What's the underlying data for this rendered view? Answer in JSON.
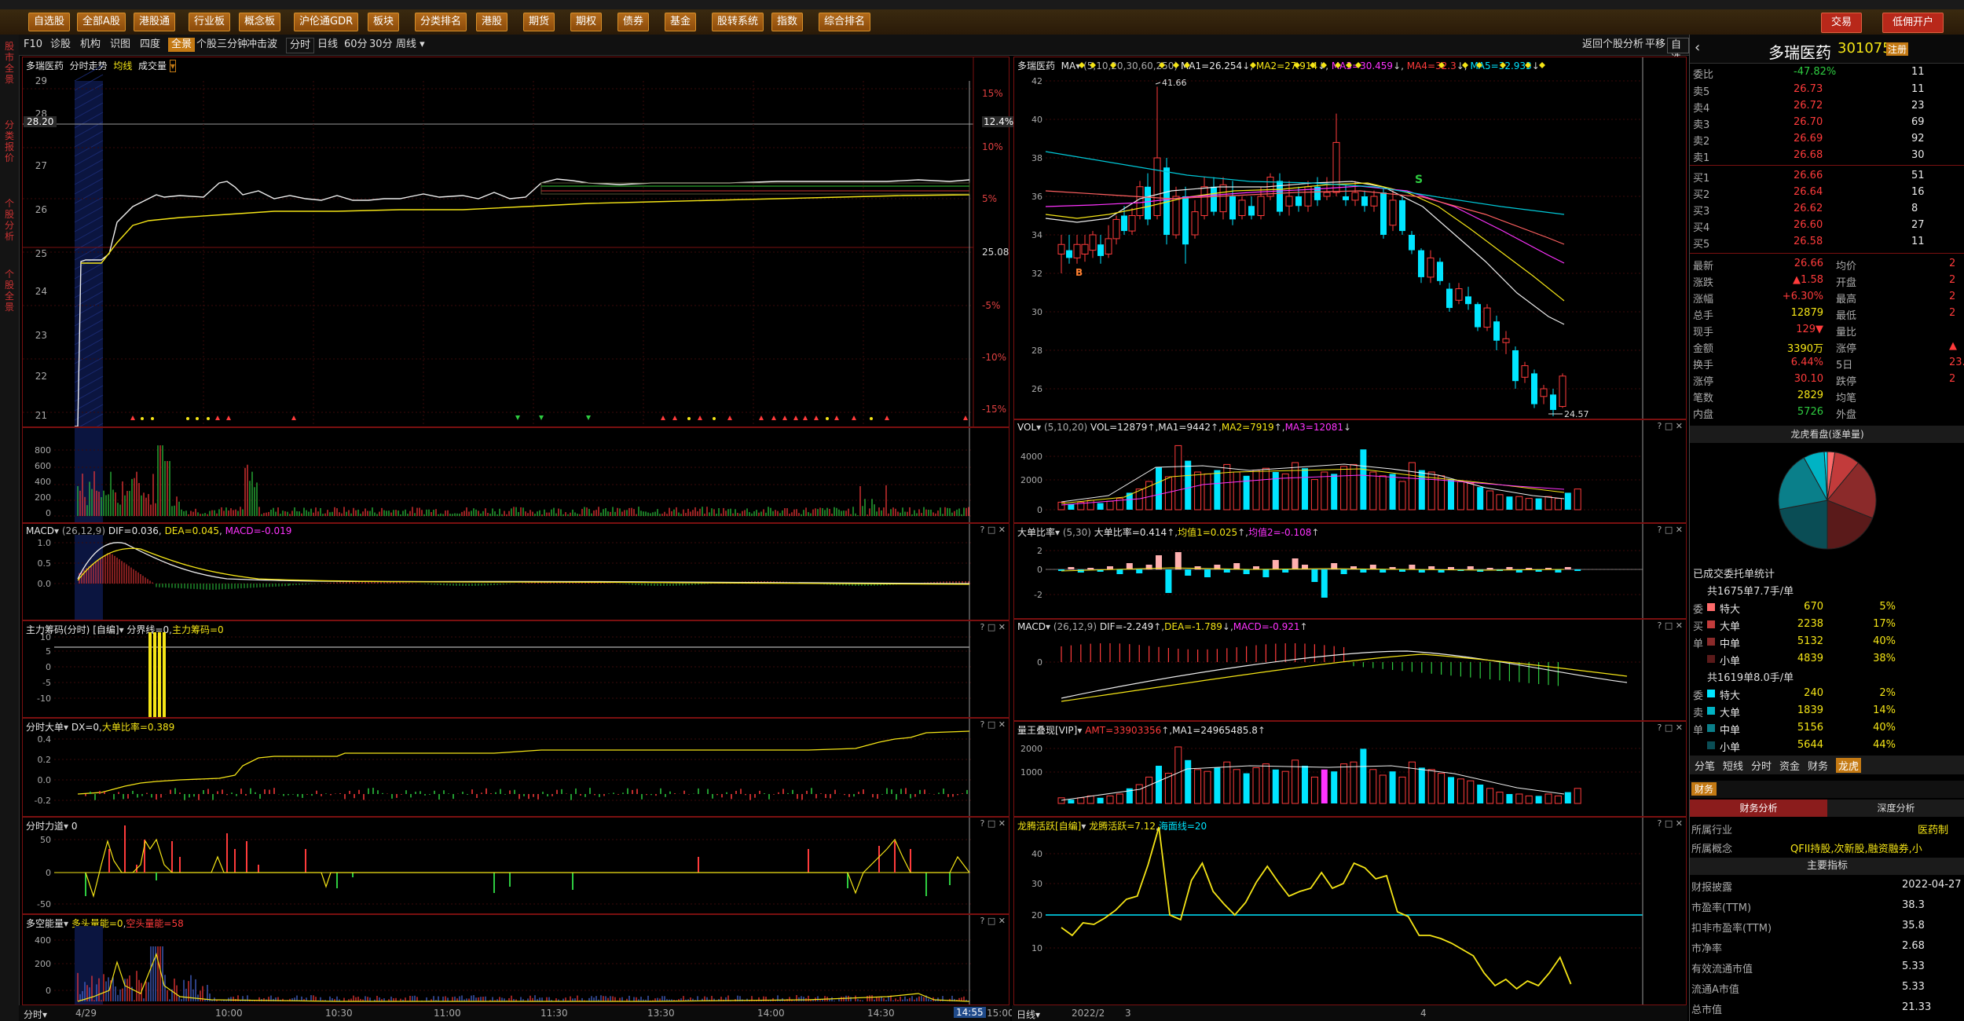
{
  "toolbar": {
    "buttons": [
      "自选股",
      "全部A股",
      "港股通",
      "行业板",
      "概念板",
      "沪伦通GDR",
      "板块",
      "分类排名",
      "港股",
      "期货",
      "期权",
      "债券",
      "基金",
      "股转系统",
      "指数",
      "综合排名"
    ],
    "right_buttons": [
      "交易",
      "低佣开户"
    ]
  },
  "left_rail": [
    "股市全景",
    "分类报价",
    "个股分析",
    "个股全景"
  ],
  "subbar": {
    "items": [
      "F10",
      "诊股",
      "机构",
      "识图",
      "四度",
      "全景",
      "个股三分钟",
      "冲击波",
      "分时",
      "日线",
      "60分",
      "30分",
      "周线"
    ],
    "active": "全景",
    "right_items": [
      "返回个股分析",
      "平移",
      "自选"
    ]
  },
  "intraday": {
    "header": {
      "name": "多瑞医药",
      "title": "分时走势",
      "avg": "均线",
      "vol": "成交量"
    },
    "y_left": [
      "29",
      "28",
      "27",
      "26",
      "25",
      "24",
      "23",
      "22",
      "21"
    ],
    "y_right": [
      "15%",
      "12.4%",
      "10%",
      "5%",
      "25.08",
      "-5%",
      "-10%",
      "-15%"
    ],
    "price_tag": "28.20",
    "price_tag_pct": "12.4%",
    "vol_y": [
      "800",
      "600",
      "400",
      "200",
      "0"
    ],
    "macd": {
      "label": "MACD",
      "params": "(26,12,9)",
      "dif": "DIF=0.036",
      "dea": "DEA=0.045",
      "macd": "MACD=-0.019",
      "y": [
        "1.0",
        "0.5",
        "0.0"
      ]
    },
    "zlcm": {
      "label": "主力筹码(分时)",
      "mode": "[自编]",
      "a": "分界线=0",
      "b": "主力筹码=0",
      "y": [
        "10",
        "5",
        "0",
        "-5",
        "-10"
      ]
    },
    "fsdd": {
      "label": "分时大单",
      "a": "DX=0",
      "b": "大单比率=0.389",
      "y": [
        "0.4",
        "0.2",
        "0.0",
        "-0.2"
      ]
    },
    "fsld": {
      "label": "分时力道",
      "a": "0",
      "y": [
        "50",
        "0",
        "-50"
      ]
    },
    "dkcl": {
      "label": "多空能量",
      "a": "多头量能=0",
      "b": "空头量能=58",
      "y": [
        "400",
        "200",
        "0"
      ]
    },
    "x_labels": [
      "4/29",
      "10:00",
      "10:30",
      "11:00",
      "11:30",
      "13:30",
      "14:00",
      "14:30",
      "14:55",
      "15:00"
    ],
    "x_left": "分时"
  },
  "daily": {
    "header": {
      "name": "多瑞医药",
      "ma": "MA",
      "params": "(5,10,20,30,60,250)",
      "ma1": "MA1=26.254",
      "ma2": "MA2=27.914",
      "ma3": "MA3=30.459",
      "ma4": "MA4=32.3",
      "ma5": "MA5=32.933"
    },
    "y": [
      "42",
      "40",
      "38",
      "36",
      "34",
      "32",
      "30",
      "28",
      "26"
    ],
    "hi_label": "41.66",
    "lo_label": "24.57",
    "vol": {
      "label": "VOL",
      "params": "(5,10,20)",
      "a": "VOL=12879",
      "b": "MA1=9442",
      "c": "MA2=7919",
      "d": "MA3=12081",
      "y": [
        "4000",
        "2000",
        "0"
      ]
    },
    "ddbl": {
      "label": "大单比率",
      "params": "(5,30)",
      "a": "大单比率=0.414",
      "b": "均值1=0.025",
      "c": "均值2=-0.108",
      "y": [
        "2",
        "0",
        "-2"
      ]
    },
    "macd": {
      "label": "MACD",
      "params": "(26,12,9)",
      "a": "DIF=-2.249",
      "b": "DEA=-1.789",
      "c": "MACD=-0.921",
      "y": [
        "0"
      ]
    },
    "lwdx": {
      "label": "量王叠现[VIP]",
      "a": "AMT=33903356",
      "b": "MA1=24965485.8",
      "y": [
        "2000",
        "1000"
      ]
    },
    "lthy": {
      "label": "龙腾活跃[自编]",
      "a": "龙腾活跃=7.12",
      "b": "海面线=20",
      "y": [
        "40",
        "30",
        "20",
        "10"
      ]
    },
    "x_labels": [
      "2022/2",
      "3",
      "4"
    ],
    "x_left": "日线"
  },
  "quote": {
    "name": "多瑞医药",
    "code": "301075",
    "tag": "注册",
    "weibi_label": "委比",
    "weibi": "-47.82%",
    "weibi_vol": "11",
    "sell": [
      [
        "卖5",
        "26.73",
        "11"
      ],
      [
        "卖4",
        "26.72",
        "23"
      ],
      [
        "卖3",
        "26.70",
        "69"
      ],
      [
        "卖2",
        "26.69",
        "92"
      ],
      [
        "卖1",
        "26.68",
        "30"
      ]
    ],
    "buy": [
      [
        "买1",
        "26.66",
        "51"
      ],
      [
        "买2",
        "26.64",
        "16"
      ],
      [
        "买3",
        "26.62",
        "8"
      ],
      [
        "买4",
        "26.60",
        "27"
      ],
      [
        "买5",
        "26.58",
        "11"
      ]
    ],
    "stats": [
      [
        "最新",
        "26.66",
        "均价",
        "2"
      ],
      [
        "涨跌",
        "▲1.58",
        "开盘",
        "2"
      ],
      [
        "涨幅",
        "+6.30%",
        "最高",
        "2"
      ],
      [
        "总手",
        "12879",
        "最低",
        "2"
      ],
      [
        "现手",
        "129▼",
        "量比",
        ""
      ],
      [
        "金额",
        "3390万",
        "涨停",
        "▲"
      ],
      [
        "换手",
        "6.44%",
        "5日",
        "23."
      ],
      [
        "涨停",
        "30.10",
        "跌停",
        "2"
      ],
      [
        "笔数",
        "2829",
        "均笔",
        ""
      ],
      [
        "内盘",
        "5726",
        "外盘",
        ""
      ]
    ],
    "pie_title": "龙虎看盘(逐单量)",
    "orders_title": "已成交委托单统计",
    "buy_total": "共1675单7.7手/单",
    "buy_rows": [
      [
        "特大",
        "670",
        "5%",
        "#ff6b6b"
      ],
      [
        "大单",
        "2238",
        "17%",
        "#c23b3b"
      ],
      [
        "中单",
        "5132",
        "40%",
        "#8b2a2a"
      ],
      [
        "小单",
        "4839",
        "38%",
        "#5a1a1a"
      ]
    ],
    "buy_side": [
      "委",
      "买",
      "单"
    ],
    "sell_total": "共1619单8.0手/单",
    "sell_rows": [
      [
        "特大",
        "240",
        "2%",
        "#00e5ff"
      ],
      [
        "大单",
        "1839",
        "14%",
        "#00b3c4"
      ],
      [
        "中单",
        "5156",
        "40%",
        "#0a7f8a"
      ],
      [
        "小单",
        "5644",
        "44%",
        "#0a4d55"
      ]
    ],
    "sell_side": [
      "委",
      "卖",
      "单"
    ],
    "tabs": [
      "分笔",
      "短线",
      "分时",
      "资金",
      "财务",
      "龙虎"
    ],
    "active_tab": "龙虎",
    "fin_tab": "财务",
    "fin_sub": [
      "财务分析",
      "深度分析"
    ],
    "industry_label": "所属行业",
    "industry": "医药制",
    "concept_label": "所属概念",
    "concept": "QFII持股,次新股,融资融券,小",
    "main_index": "主要指标",
    "fin_rows": [
      [
        "财报披露",
        "2022-04-27"
      ],
      [
        "市盈率(TTM)",
        "38.3"
      ],
      [
        "扣非市盈率(TTM)",
        "35.8"
      ],
      [
        "市净率",
        "2.68"
      ],
      [
        "有效流通市值",
        "5.33"
      ],
      [
        "流通A市值",
        "5.33"
      ],
      [
        "总市值",
        "21.33"
      ]
    ]
  }
}
